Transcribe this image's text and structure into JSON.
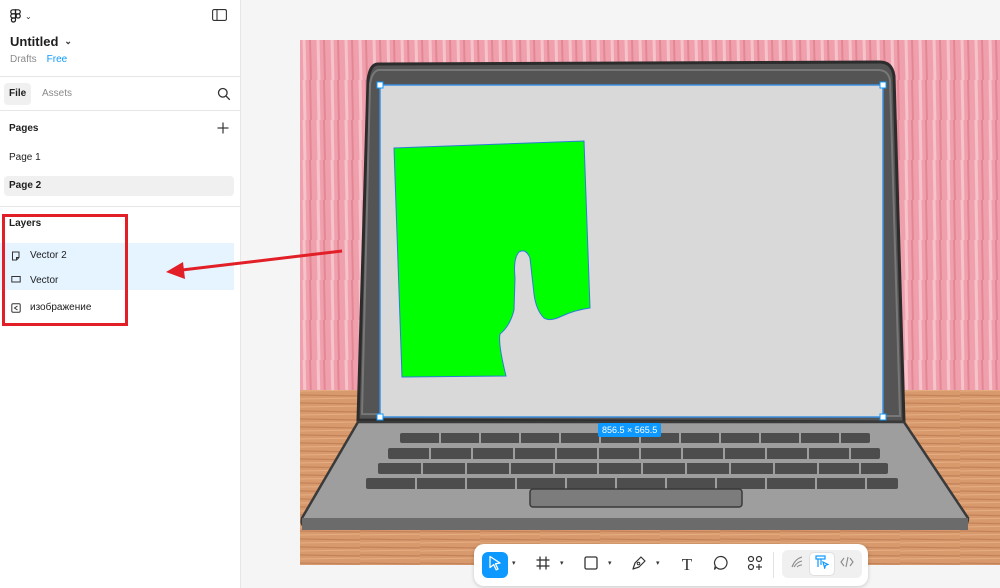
{
  "app": {
    "file_title": "Untitled",
    "location": "Drafts",
    "plan": "Free"
  },
  "tabs": [
    {
      "label": "File",
      "active": true
    },
    {
      "label": "Assets",
      "active": false
    }
  ],
  "pages": {
    "title": "Pages",
    "items": [
      {
        "label": "Page 1",
        "selected": false
      },
      {
        "label": "Page 2",
        "selected": true
      }
    ]
  },
  "layers": {
    "title": "Layers",
    "items": [
      {
        "label": "Vector 2",
        "icon": "vector-icon",
        "selected": true
      },
      {
        "label": "Vector",
        "icon": "rectangle-icon",
        "selected": true
      },
      {
        "label": "изображение",
        "icon": "image-icon",
        "selected": false
      }
    ]
  },
  "canvas": {
    "selection_dimensions": "856.5 × 565.5"
  },
  "toolbar": {
    "tools": [
      "move-tool",
      "frame-tool",
      "shape-tool",
      "pen-tool",
      "text-tool",
      "comment-tool",
      "actions-tool"
    ],
    "modes": [
      "draw-mode",
      "design-mode",
      "dev-mode"
    ]
  },
  "colors": {
    "accent": "#0d99ff",
    "annotation": "#e21e27",
    "selection_fill": "#e5f4ff",
    "mask_green": "#00ff00"
  }
}
